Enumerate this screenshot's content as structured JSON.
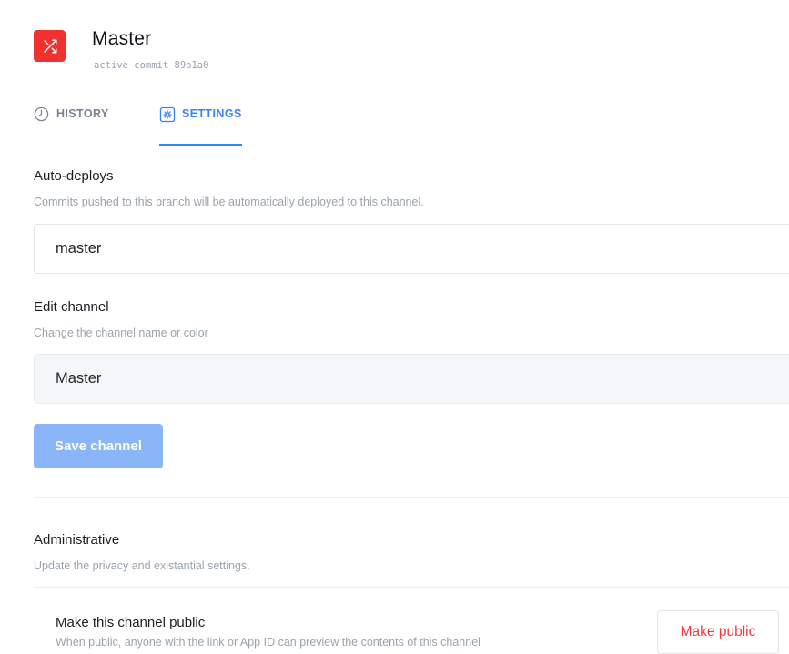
{
  "header": {
    "title": "Master",
    "commit_text": "active commit 89b1a0",
    "icon": "shuffle-icon",
    "icon_color": "#f0322e"
  },
  "tabs": [
    {
      "label": "HISTORY",
      "icon": "clock-icon",
      "active": false
    },
    {
      "label": "SETTINGS",
      "icon": "gear-icon",
      "active": true
    }
  ],
  "accent_color": "#3a84f0",
  "auto_deploys": {
    "title": "Auto-deploys",
    "description": "Commits pushed to this branch will be automatically deployed to this channel.",
    "value": "master"
  },
  "edit_channel": {
    "title": "Edit channel",
    "description": "Change the channel name or color",
    "value": "Master",
    "save_label": "Save channel"
  },
  "administrative": {
    "title": "Administrative",
    "description": "Update the privacy and existantial settings.",
    "public_title": "Make this channel public",
    "public_description": "When public, anyone with the link or App ID can preview the contents of this channel",
    "public_button": "Make public"
  }
}
